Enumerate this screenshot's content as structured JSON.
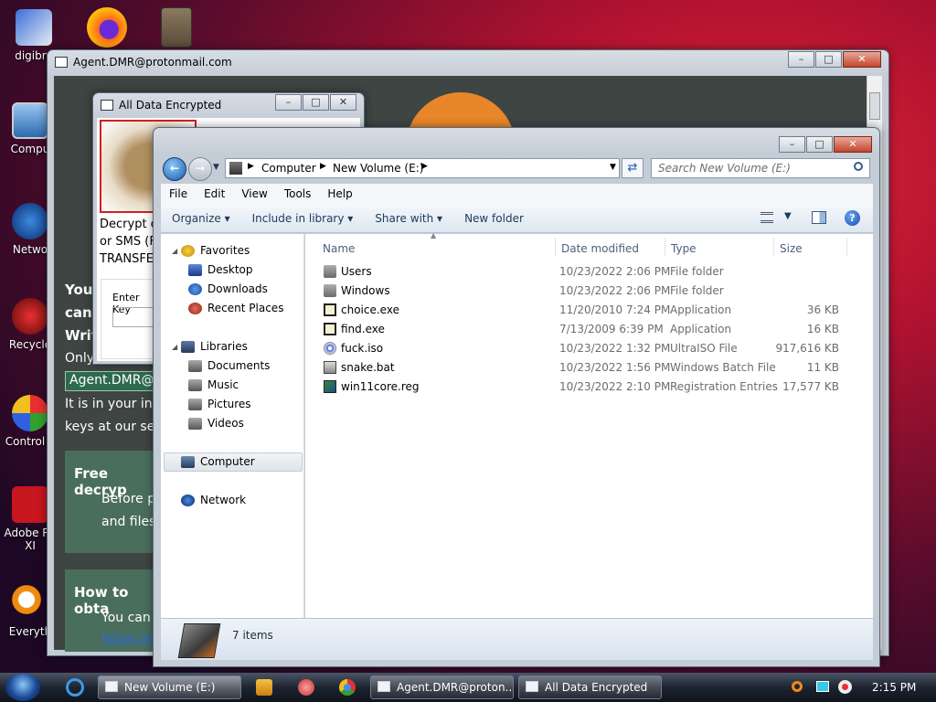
{
  "desktop": {
    "icons": [
      "digibro",
      "Compu",
      "Netwo",
      "Recycle",
      "Control P",
      "Adobe Re XI",
      "Everyth"
    ]
  },
  "ransom": {
    "title": "Agent.DMR@protonmail.com",
    "frag_you": "You",
    "frag_can": "can",
    "frag_writ": "Writ",
    "frag_only": "Only",
    "email_box": "Agent.DMR@a",
    "line_interest": "It is in your inte",
    "line_keys": "keys at our ser",
    "free_title": "Free decryp",
    "free_l1": "Before p",
    "free_l2": "and files",
    "how_title": "How to obta",
    "how_l1": "You can",
    "how_link": "https://ex"
  },
  "alldata": {
    "title": "All Data Encrypted",
    "text1": "Decrypt c",
    "text2": "or SMS (F",
    "text3": "TRANSFEI",
    "enter_key": "Enter Key"
  },
  "explorer": {
    "breadcrumb": [
      "Computer",
      "New Volume (E:)"
    ],
    "search_placeholder": "Search New Volume (E:)",
    "menu": [
      "File",
      "Edit",
      "View",
      "Tools",
      "Help"
    ],
    "toolbar": {
      "organize": "Organize",
      "include": "Include in library",
      "share": "Share with",
      "newfolder": "New folder"
    },
    "nav": {
      "favorites": "Favorites",
      "desktop": "Desktop",
      "downloads": "Downloads",
      "recent": "Recent Places",
      "libraries": "Libraries",
      "documents": "Documents",
      "music": "Music",
      "pictures": "Pictures",
      "videos": "Videos",
      "computer": "Computer",
      "network": "Network"
    },
    "columns": {
      "name": "Name",
      "date": "Date modified",
      "type": "Type",
      "size": "Size"
    },
    "files": [
      {
        "name": "Users",
        "date": "10/23/2022 2:06 PM",
        "type": "File folder",
        "size": "",
        "icon": "folder"
      },
      {
        "name": "Windows",
        "date": "10/23/2022 2:06 PM",
        "type": "File folder",
        "size": "",
        "icon": "folder"
      },
      {
        "name": "choice.exe",
        "date": "11/20/2010 7:24 PM",
        "type": "Application",
        "size": "36 KB",
        "icon": "exe"
      },
      {
        "name": "find.exe",
        "date": "7/13/2009 6:39 PM",
        "type": "Application",
        "size": "16 KB",
        "icon": "exe"
      },
      {
        "name": "fuck.iso",
        "date": "10/23/2022 1:32 PM",
        "type": "UltraISO File",
        "size": "917,616 KB",
        "icon": "iso"
      },
      {
        "name": "snake.bat",
        "date": "10/23/2022 1:56 PM",
        "type": "Windows Batch File",
        "size": "11 KB",
        "icon": "bat"
      },
      {
        "name": "win11core.reg",
        "date": "10/23/2022 2:10 PM",
        "type": "Registration Entries",
        "size": "17,577 KB",
        "icon": "reg"
      }
    ],
    "status": "7 items"
  },
  "taskbar": {
    "tasks": [
      "New Volume (E:)",
      "Agent.DMR@proton...",
      "All Data Encrypted"
    ],
    "clock": "2:15 PM"
  }
}
